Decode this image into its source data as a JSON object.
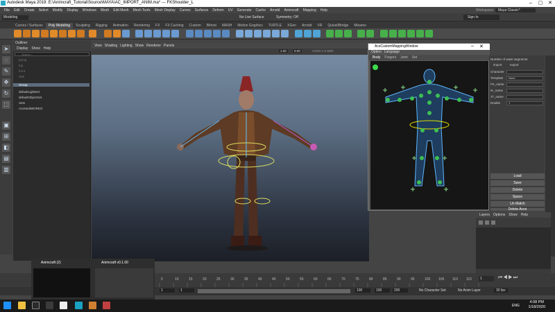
{
  "window": {
    "title": "Autodesk Maya 2019: E:\\Animcraft_Tutorial\\Source\\MAYA\\AC_IMPORT_ANIM.ma* --- FKShoulder_L",
    "workspace_label": "Workspace:",
    "workspace_value": "Maya Classic*"
  },
  "menubar": [
    "File",
    "Edit",
    "Create",
    "Select",
    "Modify",
    "Display",
    "Windows",
    "Mesh",
    "Edit Mesh",
    "Mesh Tools",
    "Mesh Display",
    "Curves",
    "Surfaces",
    "Deform",
    "UV",
    "Generate",
    "Cache",
    "Arnold",
    "Animcraft",
    "Mapping",
    "Help"
  ],
  "statusline": {
    "mode": "Modeling",
    "live_surface": "No Live Surface",
    "symmetry": "Symmetry: Off",
    "sign_in": "Sign In"
  },
  "shelf_tabs": [
    "Curves / Surfaces",
    "Poly Modeling",
    "Sculpting",
    "Rigging",
    "Animation",
    "Rendering",
    "FX",
    "FX Caching",
    "Custom",
    "Bifrost",
    "MASH",
    "Motion Graphics",
    "TURTLE",
    "XGen",
    "Arnold",
    "VR",
    "Quixel/Bridge",
    "Mixamo"
  ],
  "shelf_active": "Poly Modeling",
  "outliner": {
    "title": "Outliner",
    "menu": [
      "Display",
      "Show",
      "Help"
    ],
    "search_placeholder": "Search...",
    "items": [
      {
        "label": "persp",
        "state": "dim"
      },
      {
        "label": "top",
        "state": "dim"
      },
      {
        "label": "front",
        "state": "dim"
      },
      {
        "label": "side",
        "state": "dim"
      },
      {
        "label": "Group",
        "state": "selected"
      },
      {
        "label": "defaultLightSet",
        "state": "normal"
      },
      {
        "label": "defaultObjectSet",
        "state": "normal"
      },
      {
        "label": "Sets",
        "state": "normal"
      },
      {
        "label": "AcsNodeBOREG",
        "state": "normal"
      }
    ]
  },
  "viewport": {
    "menu": [
      "View",
      "Shading",
      "Lighting",
      "Show",
      "Renderer",
      "Panels"
    ],
    "gamma_value": "1.00",
    "exposure_value": "0.00",
    "colorspace": "ACES 1.0 SDR"
  },
  "mapping_window": {
    "title": "AcsCustomMappingWindow",
    "menu": [
      "Option",
      "Language"
    ],
    "tabs": [
      "Body",
      "Fingers",
      "Joint",
      "Set"
    ],
    "active_tab": "Body"
  },
  "mapping_panel": {
    "header": "Number of waist segments:",
    "radio_import": "import",
    "radio_export": "export",
    "fields": [
      {
        "label": "Character",
        "value": ""
      },
      {
        "label": "Template",
        "value": "None"
      },
      {
        "label": "FK_name",
        "value": ""
      },
      {
        "label": "IK_name",
        "value": ""
      },
      {
        "label": "JT_name",
        "value": ""
      },
      {
        "label": "Enable",
        "value": "1"
      }
    ],
    "buttons": [
      "Load",
      "Save",
      "Delete",
      "Space",
      "Un Match",
      "Delete Acos"
    ]
  },
  "layer_panel": {
    "menu": [
      "Layers",
      "Options",
      "Show",
      "Help"
    ]
  },
  "timeline": {
    "ticks": [
      "5",
      "10",
      "15",
      "20",
      "25",
      "30",
      "35",
      "40",
      "45",
      "50",
      "55",
      "60",
      "65",
      "70",
      "75",
      "80",
      "85",
      "90",
      "95",
      "100",
      "105",
      "110",
      "115",
      "120"
    ],
    "current_frame": "1"
  },
  "rangebar": {
    "start": "1",
    "start2": "1",
    "end": "100",
    "end2": "100",
    "anim_end": "200",
    "character_set": "No Character Set",
    "anim_layer": "No Anim Layer",
    "fps": "30 fps"
  },
  "thumbnails": [
    {
      "label": "Animcraft (2)"
    },
    {
      "label": "Animcraft v0.1.00"
    }
  ],
  "taskbar": {
    "lang": "ENG",
    "time": "4:08 PM",
    "date": "1/18/2020"
  }
}
